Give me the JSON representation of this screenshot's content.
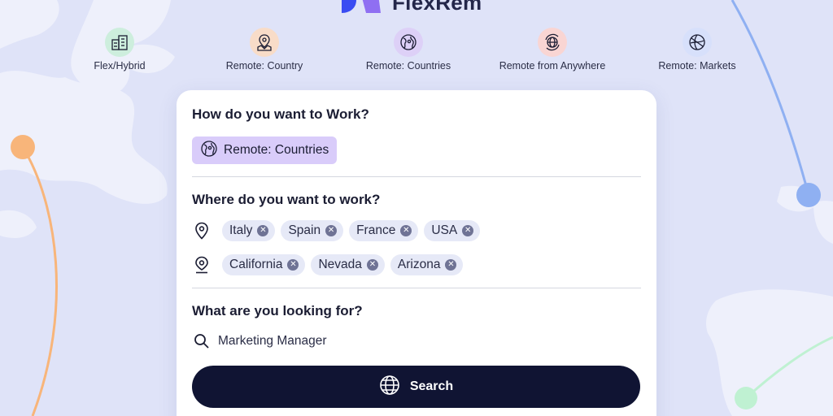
{
  "brand": {
    "name": "FlexRem"
  },
  "work_types": [
    {
      "label": "Flex/Hybrid",
      "icon": "buildings-icon",
      "color": "#cdeedd"
    },
    {
      "label": "Remote: Country",
      "icon": "map-pin-icon",
      "color": "#f8dcc8"
    },
    {
      "label": "Remote: Countries",
      "icon": "globe-pin-icon",
      "color": "#ddd0f7"
    },
    {
      "label": "Remote from Anywhere",
      "icon": "globe-orbit-icon",
      "color": "#f9d5d3"
    },
    {
      "label": "Remote: Markets",
      "icon": "globe-icon",
      "color": "#d7e0fb"
    }
  ],
  "form": {
    "how_title": "How do you want to Work?",
    "selected_type": "Remote: Countries",
    "where_title": "Where do you want to work?",
    "countries": [
      "Italy",
      "Spain",
      "France",
      "USA"
    ],
    "regions": [
      "California",
      "Nevada",
      "Arizona"
    ],
    "what_title": "What are you looking for?",
    "query": "Marketing Manager",
    "search_label": "Search"
  },
  "colors": {
    "background": "#dfe3f8",
    "button": "#101433",
    "selected_chip": "#d9ccfa",
    "tag": "#e6e9f7",
    "accent_orange": "#f8b57a",
    "accent_blue": "#8fb0f2",
    "accent_green": "#bff1d2"
  }
}
